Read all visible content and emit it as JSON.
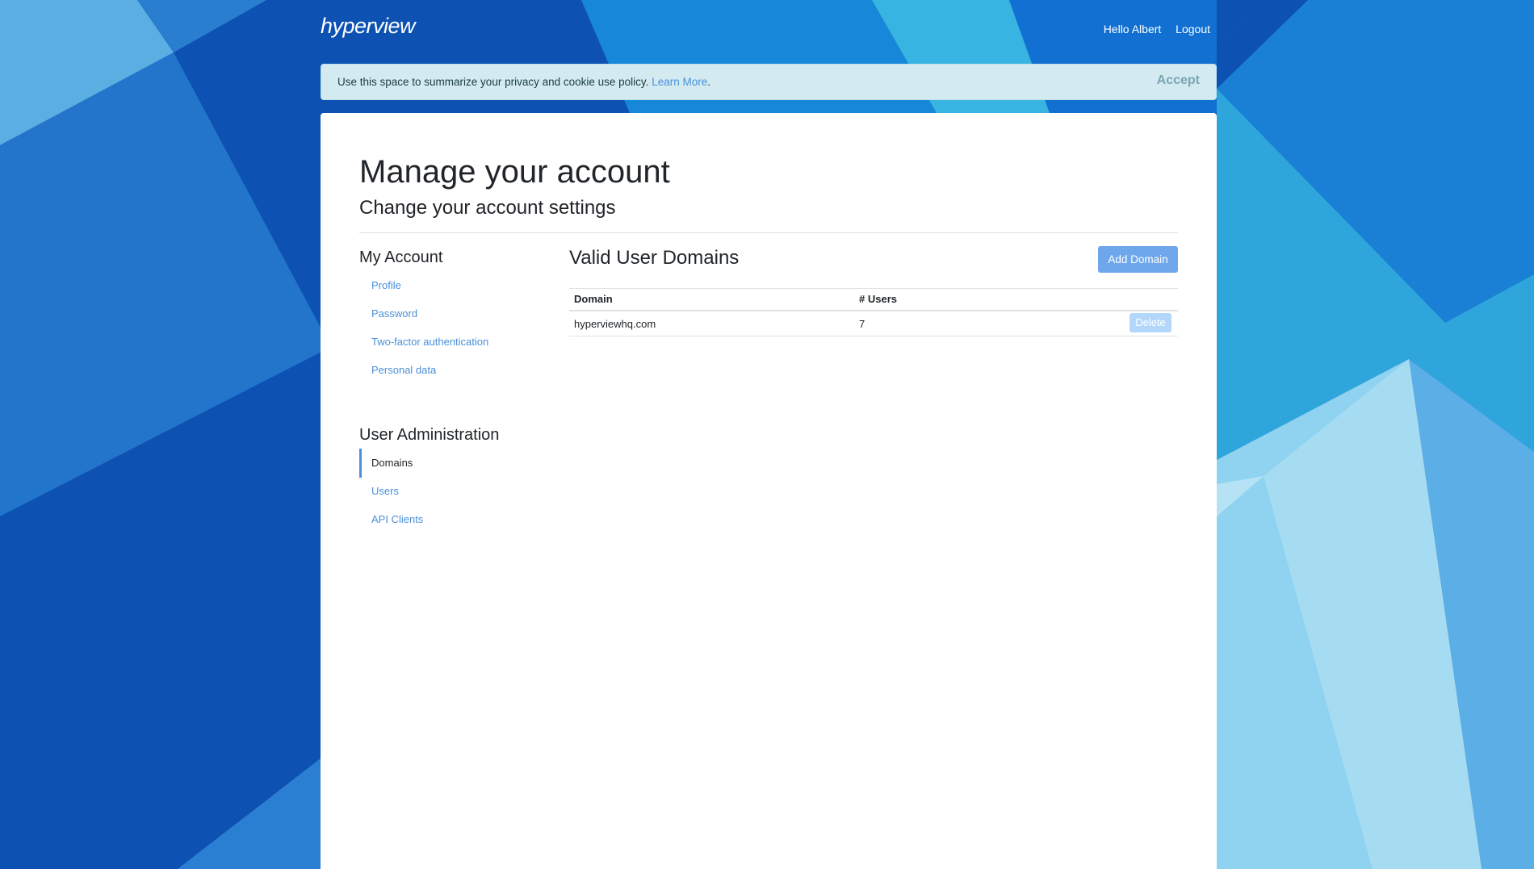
{
  "brand": {
    "logo_text": "hyperview"
  },
  "header": {
    "greeting": "Hello Albert",
    "logout": "Logout"
  },
  "cookie_banner": {
    "text": "Use this space to summarize your privacy and cookie use policy.",
    "link": "Learn More",
    "after_link": ".",
    "accept": "Accept"
  },
  "page": {
    "title": "Manage your account",
    "subtitle": "Change your account settings"
  },
  "sidebar": {
    "my_account": {
      "heading": "My Account",
      "items": [
        "Profile",
        "Password",
        "Two-factor authentication",
        "Personal data"
      ]
    },
    "user_admin": {
      "heading": "User Administration",
      "items": [
        "Domains",
        "Users",
        "API Clients"
      ],
      "active": "Domains"
    }
  },
  "main": {
    "heading": "Valid User Domains",
    "add_button": "Add Domain",
    "columns": [
      "Domain",
      "# Users"
    ],
    "rows": [
      {
        "domain": "hyperviewhq.com",
        "users": "7",
        "action": "Delete"
      }
    ]
  },
  "colors": {
    "accent": "#4a90d9",
    "button_primary": "#6ea7ec",
    "button_disabled": "#b3d7fb",
    "cookie_bg": "#d2eaf0"
  }
}
